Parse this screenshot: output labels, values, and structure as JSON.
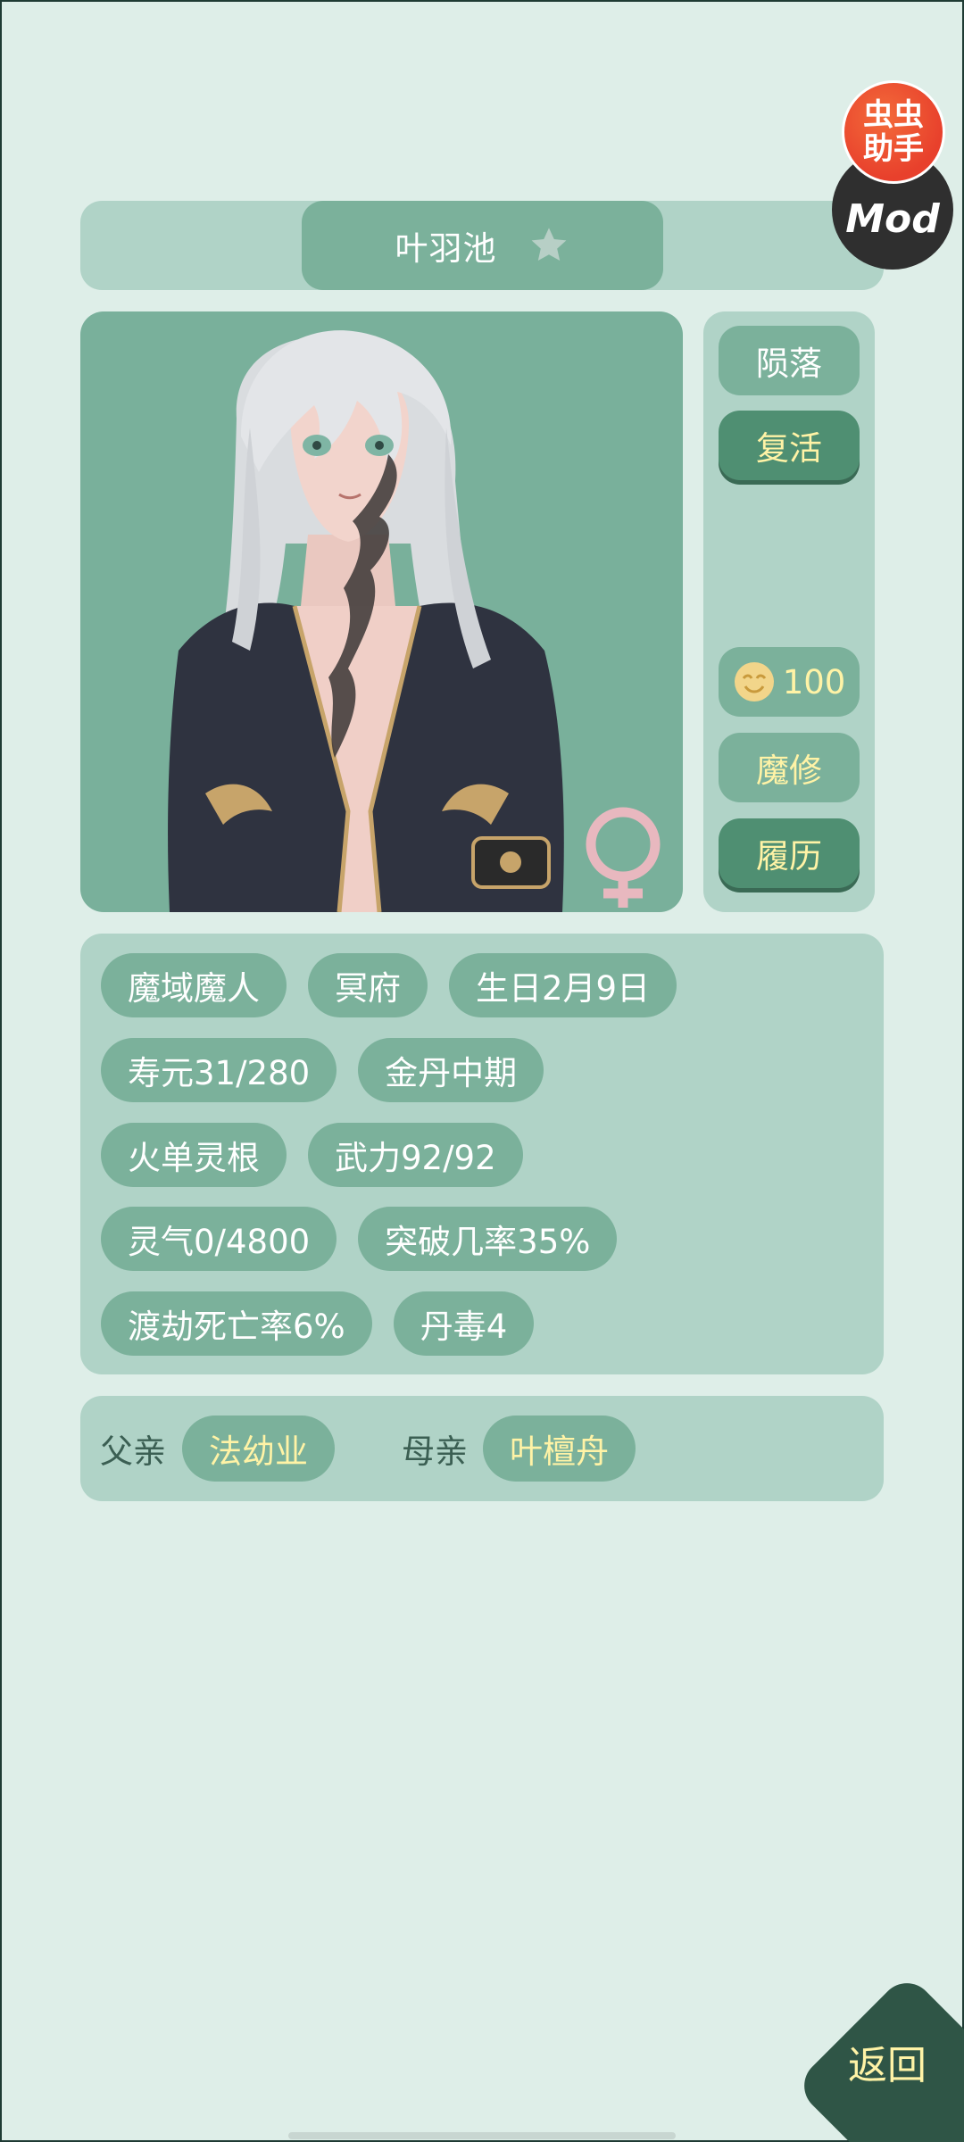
{
  "character": {
    "name": "叶羽池",
    "gender_symbol": "♀"
  },
  "mod_badge": {
    "line1": "虫虫",
    "line2": "助手",
    "mod": "Mod"
  },
  "side_actions": {
    "fallen": "陨落",
    "revive": "复活",
    "mood_value": "100",
    "demon_cultivate": "魔修",
    "resume": "履历"
  },
  "info_tags": {
    "row1": [
      "魔域魔人",
      "冥府",
      "生日2月9日"
    ],
    "row2": [
      "寿元31/280",
      "金丹中期"
    ],
    "row3": [
      "火单灵根",
      "武力92/92"
    ],
    "row4": [
      "灵气0/4800",
      "突破几率35%"
    ],
    "row5": [
      "渡劫死亡率6%",
      "丹毒4"
    ]
  },
  "parents": {
    "father_label": "父亲",
    "father_name": "法幼业",
    "mother_label": "母亲",
    "mother_name": "叶檀舟"
  },
  "back_label": "返回",
  "colors": {
    "background": "#deeee8",
    "panel": "#b0d3c7",
    "pill": "#7bb19b",
    "dark_button": "#4f8f72",
    "highlight_text": "#fff3a6",
    "back_button": "#2f5546"
  }
}
